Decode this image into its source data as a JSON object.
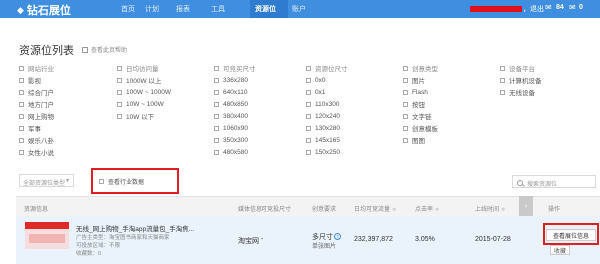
{
  "nav": {
    "logo": "钻石展位",
    "items": [
      "首页",
      "计划",
      "报表",
      "工具",
      "资源位",
      "账户"
    ],
    "active_index": 4,
    "user_tail": "，退出",
    "mail_count": "84",
    "msg_count": "0"
  },
  "page": {
    "title": "资源位列表",
    "help_link": "查看此页帮助"
  },
  "filters": {
    "col1": [
      "网站行业",
      "影视",
      "综合门户",
      "地方门户",
      "网上购物",
      "军事",
      "娱乐八卦",
      "女性小说"
    ],
    "col2": [
      "日均访问量",
      "1000W 以上",
      "100W ~ 1000W",
      "10W ~ 100W",
      "10W 以下"
    ],
    "col3": [
      "可竞买尺寸",
      "336x280",
      "640x110",
      "480x850",
      "380x400",
      "1060x90",
      "350x300",
      "480x580"
    ],
    "col4": [
      "资源位尺寸",
      "0x0",
      "0x1",
      "110x300",
      "120x240",
      "130x280",
      "145x165",
      "150x250"
    ],
    "col5": [
      "创意类型",
      "图片",
      "Flash",
      "按钮",
      "文字链",
      "创意模板",
      "图图"
    ],
    "col6": [
      "设备平台",
      "计算机设备",
      "无线设备"
    ]
  },
  "toolbar": {
    "select_value": "全部资源位类型",
    "industry_checkbox": "查看行业数据",
    "search_placeholder": "搜索资源位"
  },
  "table": {
    "headers": [
      "资源信息",
      "媒体信息",
      "可竞投尺寸",
      "创意要求",
      "日均可竞流量",
      "点击率",
      "上线时间",
      "操作"
    ],
    "row": {
      "title": "无线_网上购物_手淘app流量包_手淘焦...",
      "meta1": "广告主类型：淘宝图书商家和天猫商家",
      "meta2": "可投放区域：不限",
      "meta3": "收藏数：0",
      "media": "淘宝网",
      "size": "-",
      "creative_size": "多尺寸",
      "creative_type": "单张图片",
      "traffic": "232,397,872",
      "ctr": "3.05%",
      "online": "2015-07-28",
      "view_btn": "查看展位信息",
      "fav_btn": "收藏"
    }
  },
  "colors": {
    "nav_bg": "#3f8ee0",
    "highlight": "#e02020",
    "row_bg": "#eaf3fb"
  }
}
